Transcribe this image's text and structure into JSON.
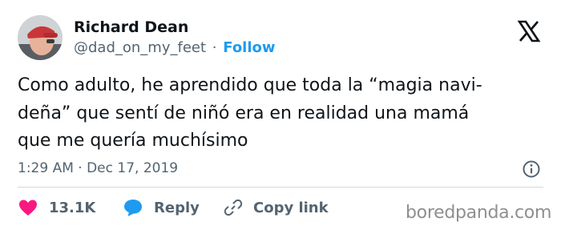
{
  "author": {
    "name": "Richard Dean",
    "handle": "@dad_on_my_feet",
    "separator": "·",
    "follow_label": "Follow"
  },
  "tweet": {
    "lines": [
      "Como adulto, he aprendido que toda la “magia navi-",
      "deña” que sentí de niñó era en realidad una mamá",
      "que me quería muchísimo"
    ],
    "timestamp": "1:29 AM · Dec 17, 2019"
  },
  "actions": {
    "likes": "13.1K",
    "reply": "Reply",
    "copy_link": "Copy link"
  },
  "watermark": "boredpanda.com",
  "icons": {
    "logo": "x-logo-icon",
    "info": "info-icon",
    "like": "heart-icon",
    "reply": "speech-bubble-icon",
    "link": "link-icon"
  },
  "colors": {
    "accent": "#1d9bf0",
    "like": "#f91880",
    "text": "#0f1419",
    "secondary": "#536471"
  }
}
